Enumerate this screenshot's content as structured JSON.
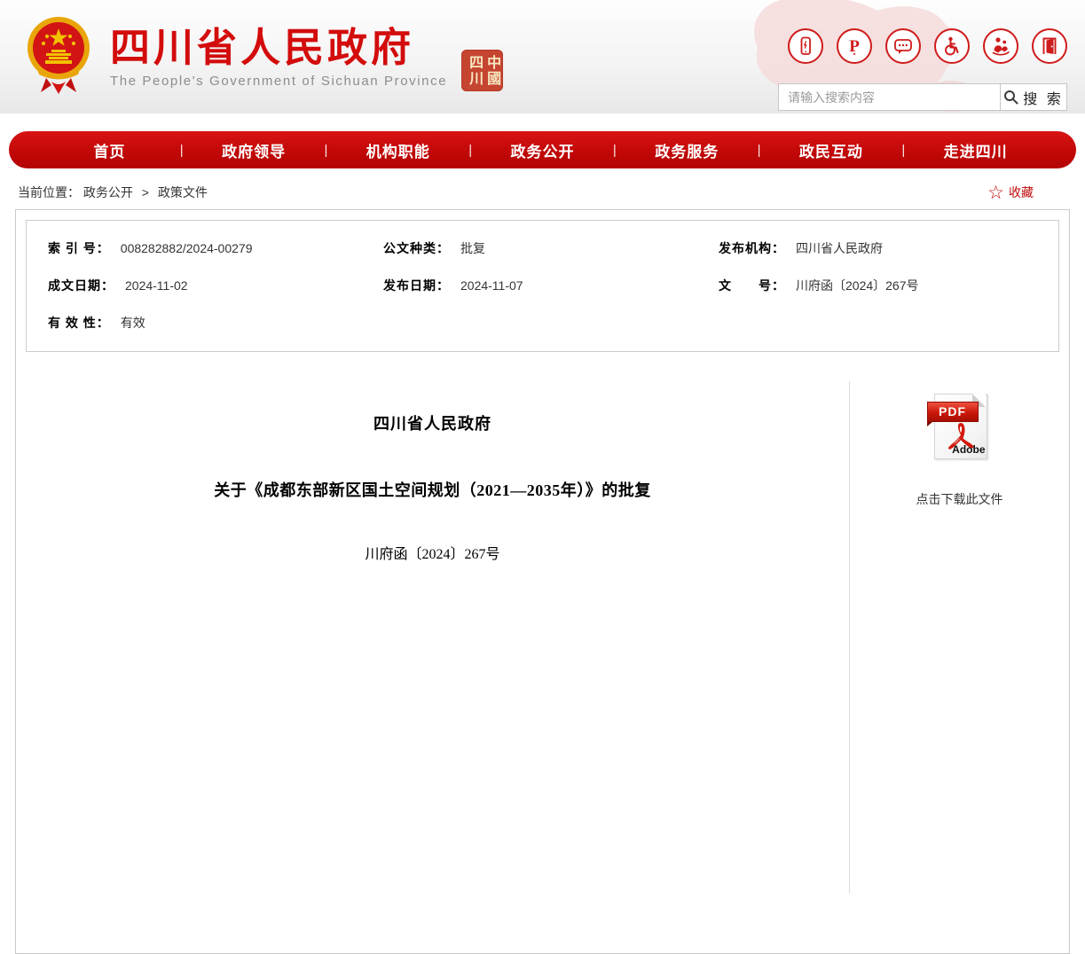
{
  "header": {
    "site_title": "四川省人民政府",
    "site_subtitle": "The People's Government of Sichuan Province",
    "seal_text": "中國四川",
    "icons": [
      {
        "name": "mobile-icon"
      },
      {
        "name": "media-p-icon",
        "glyph": "P"
      },
      {
        "name": "message-icon"
      },
      {
        "name": "accessibility-icon"
      },
      {
        "name": "elder-care-icon"
      },
      {
        "name": "door-icon"
      }
    ],
    "search": {
      "placeholder": "请输入搜索内容",
      "button_label": "搜 索"
    }
  },
  "nav": {
    "separator": "|",
    "items": [
      "首页",
      "政府领导",
      "机构职能",
      "政务公开",
      "政务服务",
      "政民互动",
      "走进四川"
    ]
  },
  "breadcrumb": {
    "label": "当前位置：",
    "items": [
      "政务公开",
      "政策文件"
    ],
    "separator": ">",
    "favorite_star_glyph": "☆",
    "favorite_label": "收藏"
  },
  "metadata": {
    "fields": [
      {
        "label": "索 引 号：",
        "value": "008282882/2024-00279"
      },
      {
        "label": "公文种类：",
        "value": "批复"
      },
      {
        "label": "发布机构：",
        "value": "四川省人民政府"
      },
      {
        "label": "成文日期：",
        "value": "2024-11-02"
      },
      {
        "label": "发布日期：",
        "value": "2024-11-07"
      },
      {
        "label": "文　　号：",
        "value": "川府函〔2024〕267号"
      },
      {
        "label": "有 效 性：",
        "value": "有效"
      }
    ]
  },
  "document": {
    "title_line1": "四川省人民政府",
    "title_line2": "关于《成都东部新区国土空间规划（2021—2035年）》的批复",
    "doc_number": "川府函〔2024〕267号"
  },
  "download": {
    "pdf_label": "PDF",
    "adobe_label": "Adobe",
    "link_text": "点击下载此文件"
  },
  "colors": {
    "accent_red": "#c00a0a",
    "nav_red": "#c50d0d",
    "seal_red": "#c64531"
  }
}
